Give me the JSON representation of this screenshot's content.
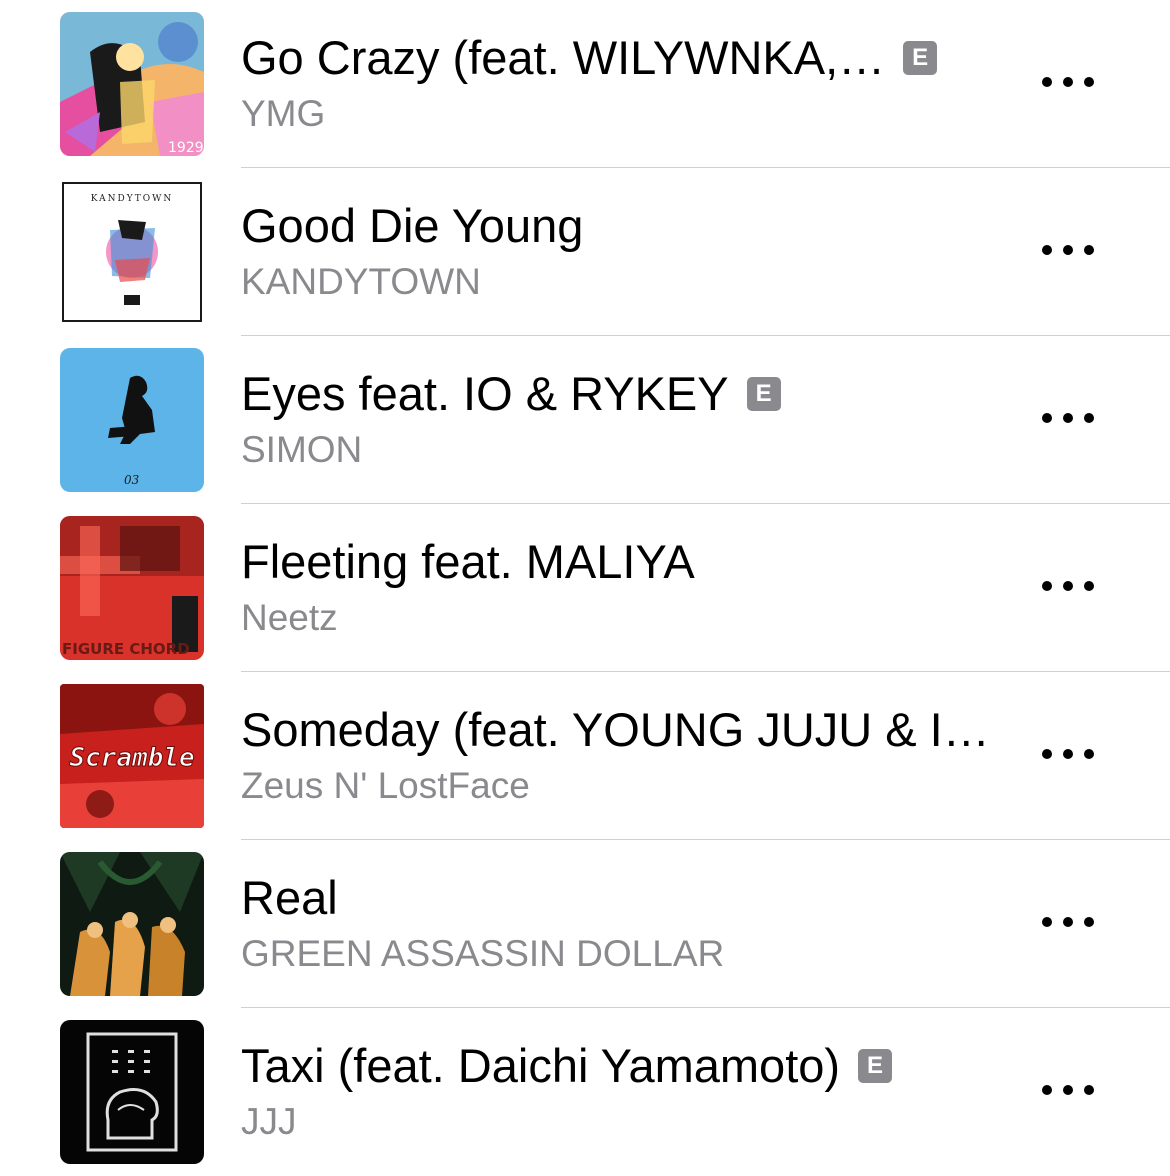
{
  "tracks": [
    {
      "title": "Go Crazy (feat. WILYWNKA,…",
      "artist": "YMG",
      "explicit": true,
      "explicit_label": "E",
      "art_icon": "album-art-go-crazy"
    },
    {
      "title": "Good Die Young",
      "artist": "KANDYTOWN",
      "explicit": false,
      "art_icon": "album-art-kandytown",
      "art_text": "KANDYTOWN"
    },
    {
      "title": "Eyes feat. IO & RYKEY",
      "artist": "SIMON",
      "explicit": true,
      "explicit_label": "E",
      "art_icon": "album-art-simon",
      "art_text": "03"
    },
    {
      "title": "Fleeting feat. MALIYA",
      "artist": "Neetz",
      "explicit": false,
      "art_icon": "album-art-figure-chord",
      "art_text": "FIGURE CHORD"
    },
    {
      "title": "Someday (feat. YOUNG JUJU & I…",
      "artist": "Zeus N' LostFace",
      "explicit": false,
      "art_icon": "album-art-scramble",
      "art_text": "Scramble"
    },
    {
      "title": "Real",
      "artist": "GREEN ASSASSIN DOLLAR",
      "explicit": false,
      "art_icon": "album-art-green-assassin"
    },
    {
      "title": "Taxi (feat. Daichi Yamamoto)",
      "artist": "JJJ",
      "explicit": true,
      "explicit_label": "E",
      "art_icon": "album-art-jjj"
    }
  ],
  "more_icon": "ellipsis-icon",
  "colors": {
    "secondary_text": "#8a8a8e",
    "explicit_badge": "#8a8a8e",
    "separator": "#d0d0d4"
  }
}
